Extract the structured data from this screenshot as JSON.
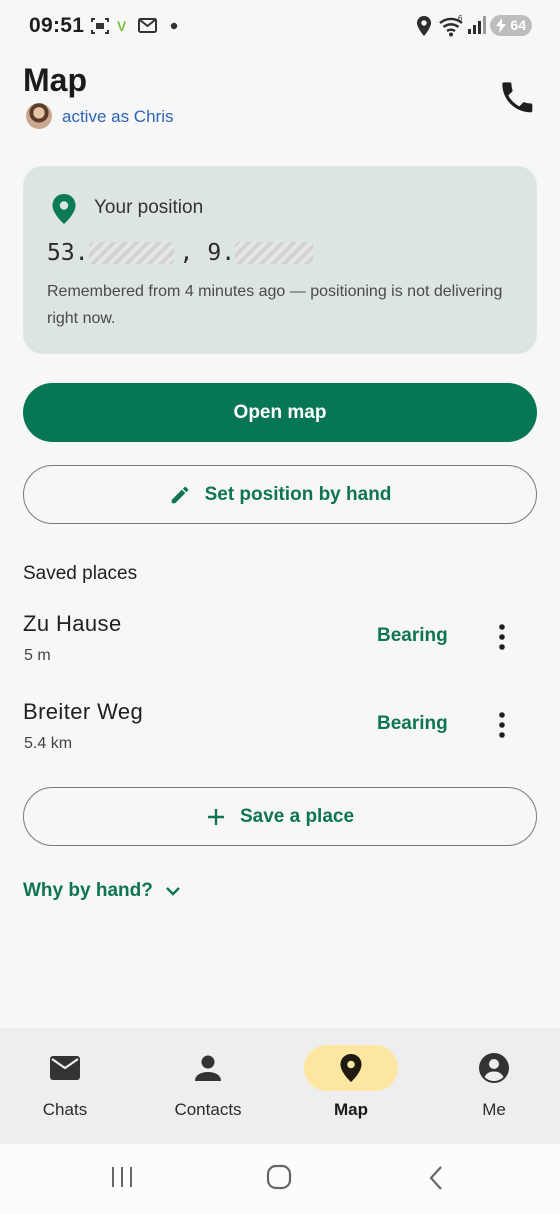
{
  "status_bar": {
    "time": "09:51",
    "battery": "64",
    "icons": [
      "screenshot-icon",
      "vpn-icon",
      "mail-icon",
      "dot-icon",
      "location-icon",
      "wifi-icon",
      "signal-icon",
      "battery-charging-icon"
    ]
  },
  "header": {
    "title": "Map",
    "active_as": "active as Chris",
    "call_icon": "phone-icon"
  },
  "position_card": {
    "title": "Your position",
    "lat_prefix": "53.",
    "separator": ",",
    "lon_prefix": "9.",
    "note": "Remembered from 4 minutes ago — positioning is not delivering right now."
  },
  "actions": {
    "open_map": "Open map",
    "set_position": "Set position by hand",
    "save_place": "Save a place"
  },
  "saved_places": {
    "title": "Saved places",
    "items": [
      {
        "name": "Zu Hause",
        "distance": "5 m",
        "action": "Bearing"
      },
      {
        "name": "Breiter Weg",
        "distance": "5.4 km",
        "action": "Bearing"
      }
    ]
  },
  "why_link": "Why by hand?",
  "bottom_nav": {
    "items": [
      {
        "label": "Chats",
        "icon": "mail-icon"
      },
      {
        "label": "Contacts",
        "icon": "person-icon"
      },
      {
        "label": "Map",
        "icon": "location-pin-icon",
        "active": true
      },
      {
        "label": "Me",
        "icon": "account-circle-icon"
      }
    ]
  },
  "colors": {
    "accent": "#077655",
    "accent_text": "#0f7551",
    "card_bg": "#dde5e0",
    "active_nav": "#fce7a2",
    "link_blue": "#2d63b4"
  }
}
